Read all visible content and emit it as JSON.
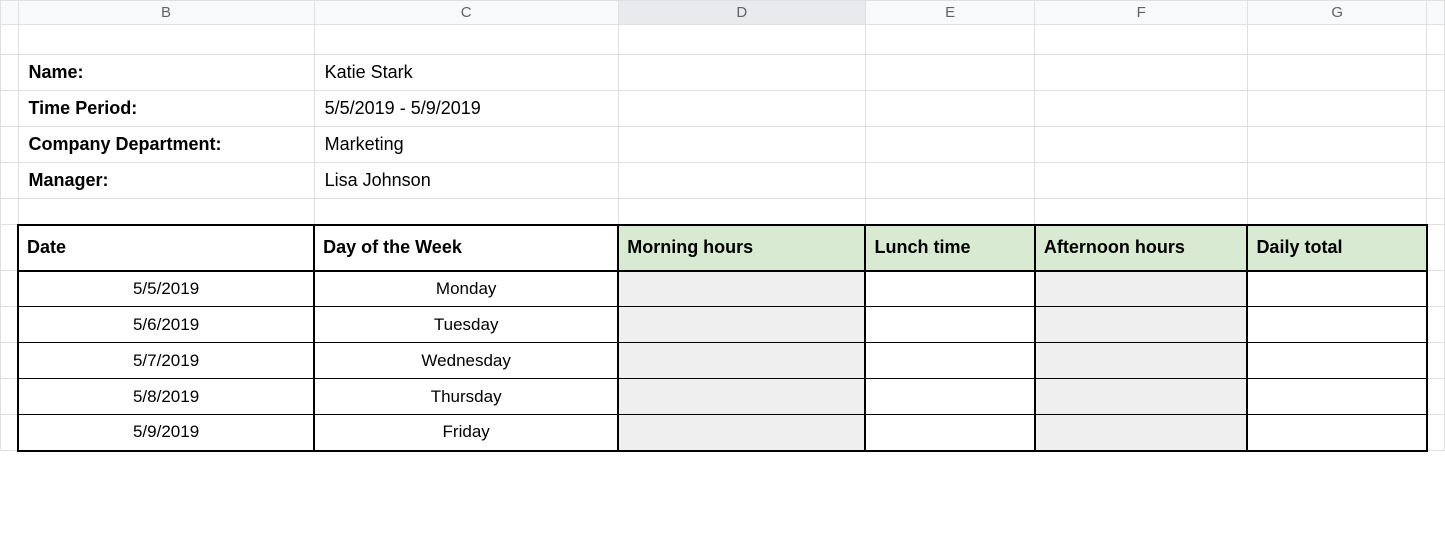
{
  "columns": {
    "b": "B",
    "c": "C",
    "d": "D",
    "e": "E",
    "f": "F",
    "g": "G"
  },
  "info": {
    "name_label": "Name:",
    "name_value": "Katie Stark",
    "period_label": "Time Period:",
    "period_value": "5/5/2019 - 5/9/2019",
    "dept_label": "Company Department:",
    "dept_value": "Marketing",
    "manager_label": "Manager:",
    "manager_value": "Lisa Johnson"
  },
  "table": {
    "headers": {
      "date": "Date",
      "day": "Day of the Week",
      "morning": "Morning hours",
      "lunch": "Lunch time",
      "afternoon": "Afternoon hours",
      "total": "Daily total"
    },
    "rows": [
      {
        "date": "5/5/2019",
        "day": "Monday",
        "morning": "",
        "lunch": "",
        "afternoon": "",
        "total": ""
      },
      {
        "date": "5/6/2019",
        "day": "Tuesday",
        "morning": "",
        "lunch": "",
        "afternoon": "",
        "total": ""
      },
      {
        "date": "5/7/2019",
        "day": "Wednesday",
        "morning": "",
        "lunch": "",
        "afternoon": "",
        "total": ""
      },
      {
        "date": "5/8/2019",
        "day": "Thursday",
        "morning": "",
        "lunch": "",
        "afternoon": "",
        "total": ""
      },
      {
        "date": "5/9/2019",
        "day": "Friday",
        "morning": "",
        "lunch": "",
        "afternoon": "",
        "total": ""
      }
    ]
  }
}
